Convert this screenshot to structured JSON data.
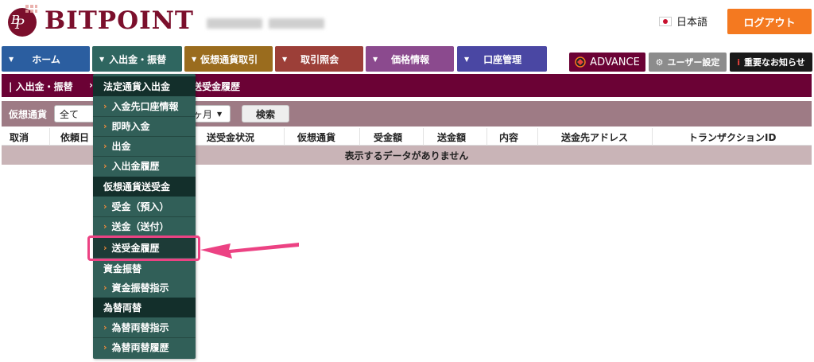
{
  "header": {
    "brand": "BITPOINT",
    "language": "日本語",
    "logout_label": "ログアウト"
  },
  "nav": {
    "items": [
      {
        "label": "ホーム",
        "color": "#2b5ea0"
      },
      {
        "label": "入出金・振替",
        "color": "#2f6660"
      },
      {
        "label": "仮想通貨取引",
        "color": "#9a6c1e"
      },
      {
        "label": "取引照会",
        "color": "#9c3f38"
      },
      {
        "label": "価格情報",
        "color": "#8b4a8e"
      },
      {
        "label": "口座管理",
        "color": "#4a47a3"
      }
    ],
    "advance_label": "ADVANCE",
    "user_settings_label": "ユーザー設定",
    "notice_label": "重要なお知らせ"
  },
  "breadcrumb": {
    "section": "入出金・振替",
    "arrow": "›",
    "page": "送受金履歴"
  },
  "filter": {
    "currency_label": "仮想通貨",
    "currency_value": "全て",
    "period_value": "ヶ月",
    "search_label": "検索"
  },
  "table": {
    "columns": [
      "取消",
      "依頼日",
      "送受金状況",
      "仮想通貨",
      "受金額",
      "送金額",
      "内容",
      "送金先アドレス",
      "トランザクションID"
    ],
    "empty_message": "表示するデータがありません"
  },
  "menu": {
    "section_fiat": "法定通貨入出金",
    "fiat_items": [
      "入金先口座情報",
      "即時入金",
      "出金",
      "入出金履歴"
    ],
    "section_crypto": "仮想通貨送受金",
    "crypto_items": [
      "受金（預入）",
      "送金（送付）",
      "送受金履歴"
    ],
    "section_transfer": "資金振替",
    "transfer_items": [
      "資金振替指示"
    ],
    "section_fx": "為替両替",
    "fx_items": [
      "為替両替指示",
      "為替両替履歴"
    ]
  },
  "colors": {
    "brand": "#7b0f2c",
    "logout": "#f47920",
    "highlight_arrow": "#ec4283"
  }
}
